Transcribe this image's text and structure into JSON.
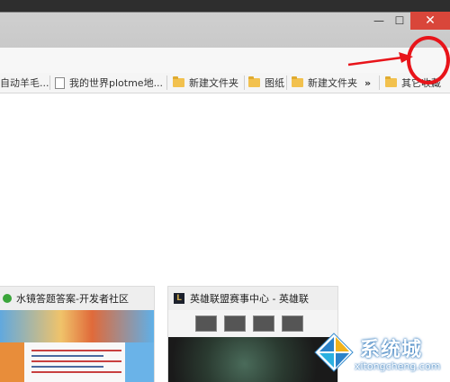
{
  "window": {
    "minimize_glyph": "—",
    "maximize_glyph": "☐",
    "close_glyph": "✕",
    "close_color": "#d9463a"
  },
  "toolbar": {
    "menu_glyph": "≡",
    "menu_icon": "hamburger-menu-icon",
    "accent": "#3c6fb5"
  },
  "bookmarks": {
    "items": [
      {
        "label": "自动羊毛...",
        "icon": "none"
      },
      {
        "label": "我的世界plotme地...",
        "icon": "page-icon"
      },
      {
        "label": "新建文件夹",
        "icon": "folder-icon"
      },
      {
        "label": "图纸",
        "icon": "folder-icon"
      },
      {
        "label": "新建文件夹",
        "icon": "folder-icon"
      }
    ],
    "overflow_glyph": "»",
    "other_label": "其它收藏"
  },
  "tiles": [
    {
      "title": "水镜答题答案-开发者社区",
      "favicon": "green-dot-icon"
    },
    {
      "title": "英雄联盟赛事中心 - 英雄联",
      "favicon": "lol-icon",
      "favicon_text": "L"
    }
  ],
  "annotation": {
    "color": "#e8141a"
  },
  "watermark": {
    "cn": "系统城",
    "en": "xitongcheng.com"
  }
}
